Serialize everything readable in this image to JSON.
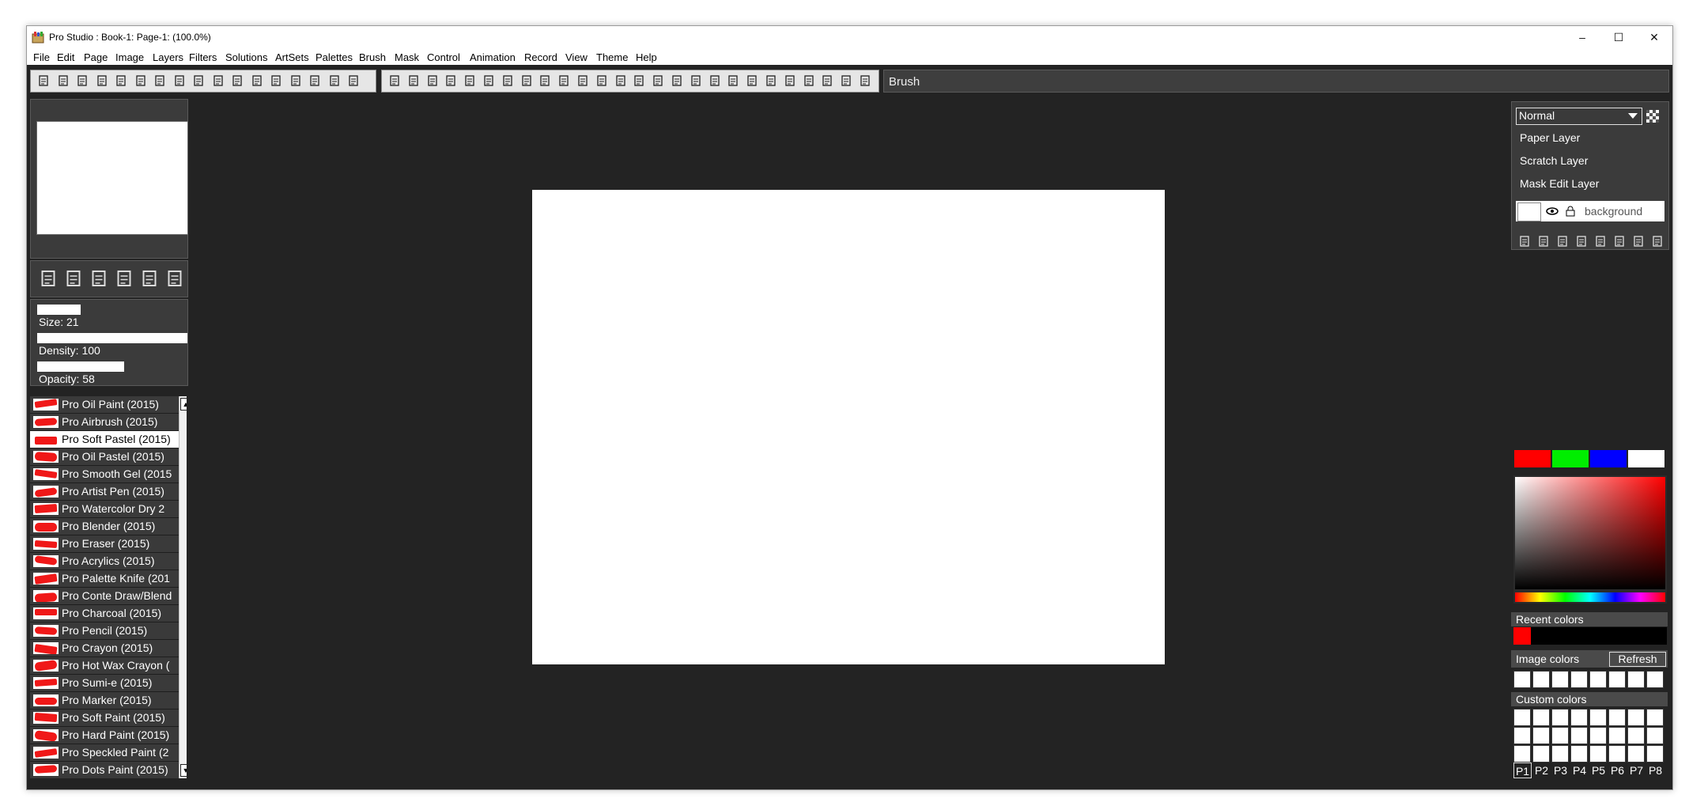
{
  "window": {
    "title": "Pro Studio : Book-1: Page-1:  (100.0%)",
    "controls": {
      "minimize": "–",
      "maximize": "☐",
      "close": "✕"
    }
  },
  "menu": [
    "File",
    "Edit",
    "Page",
    "Image",
    "Layers",
    "Filters",
    "Solutions",
    "ArtSets",
    "Palettes",
    "Brush",
    "Mask",
    "Control",
    "Animation",
    "Record",
    "View",
    "Theme",
    "Help"
  ],
  "toolbar": {
    "file_icons": [
      "save-icon",
      "new-page-icon",
      "open-icon",
      "import-icon",
      "export-icon",
      "print-icon",
      "brush-settings-icon",
      "copy-page-icon",
      "cut-icon",
      "copy-icon",
      "paste-icon",
      "duplicate-icon",
      "clear-icon",
      "undo-icon",
      "redo-icon",
      "flip-icon",
      "zoom-icon"
    ],
    "tool_icons": [
      "brush-tool-icon",
      "eyedropper-icon",
      "bucket-icon",
      "select-rect-icon",
      "crop-icon",
      "move-icon",
      "line-icon",
      "curve-icon",
      "rectangle-icon",
      "ellipse-icon",
      "fill-icon",
      "gradient-icon",
      "pattern-icon",
      "warp-icon",
      "perspective-icon",
      "rotate-icon",
      "lasso-icon",
      "magic-wand-icon",
      "smudge-icon",
      "clone-icon",
      "stamp-icon",
      "text-icon",
      "hand-icon",
      "wheel-icon",
      "ruler-icon",
      "smart-brush-icon"
    ],
    "tool_name": "Brush"
  },
  "brush_panel": {
    "tool_icons": [
      "rotate-canvas-icon",
      "refresh-icon",
      "pick-brush-icon",
      "page-icon",
      "brush-lock-icon",
      "settings-icon"
    ],
    "sliders": [
      {
        "label": "Size: 21",
        "value": 0.29
      },
      {
        "label": "Density: 100",
        "value": 1.0
      },
      {
        "label": "Opacity: 58",
        "value": 0.58
      }
    ]
  },
  "brushes": {
    "selected_index": 2,
    "items": [
      {
        "label": "Pro Oil Paint (2015)"
      },
      {
        "label": "Pro Airbrush (2015)"
      },
      {
        "label": "Pro Soft Pastel (2015)"
      },
      {
        "label": "Pro Oil Pastel (2015)"
      },
      {
        "label": "Pro Smooth Gel (2015"
      },
      {
        "label": "Pro Artist Pen (2015)"
      },
      {
        "label": "Pro Watercolor Dry 2"
      },
      {
        "label": "Pro Blender (2015)"
      },
      {
        "label": "Pro Eraser (2015)"
      },
      {
        "label": "Pro Acrylics (2015)"
      },
      {
        "label": "Pro Palette Knife (201"
      },
      {
        "label": "Pro Conte Draw/Blend"
      },
      {
        "label": "Pro Charcoal (2015)"
      },
      {
        "label": "Pro Pencil (2015)"
      },
      {
        "label": "Pro Crayon (2015)"
      },
      {
        "label": "Pro Hot Wax Crayon ("
      },
      {
        "label": "Pro Sumi-e (2015)"
      },
      {
        "label": "Pro Marker (2015)"
      },
      {
        "label": "Pro Soft Paint (2015)"
      },
      {
        "label": "Pro Hard Paint (2015)"
      },
      {
        "label": "Pro Speckled Paint (2"
      },
      {
        "label": "Pro Dots Paint (2015)"
      }
    ],
    "scroll_up": "▲",
    "scroll_down": "▼"
  },
  "layers": {
    "blend_mode": "Normal",
    "items": [
      "Paper Layer",
      "Scratch Layer",
      "Mask Edit Layer"
    ],
    "active_layer": "background",
    "action_icons": [
      "add-layer-icon",
      "import-layer-icon",
      "duplicate-layer-icon",
      "delete-layer-icon",
      "merge-layer-icon",
      "layer-order-icon",
      "layer-list-icon",
      "layer-properties-icon"
    ]
  },
  "colors": {
    "swatches": [
      "#ff0000",
      "#00ee00",
      "#0000ff",
      "#ffffff"
    ],
    "recent_label": "Recent colors",
    "recent": [
      "#ff0000"
    ],
    "image_label": "Image colors",
    "refresh_label": "Refresh",
    "custom_label": "Custom colors",
    "palette_tabs": [
      "P1",
      "P2",
      "P3",
      "P4",
      "P5",
      "P6",
      "P7",
      "P8"
    ],
    "active_tab": 0
  }
}
